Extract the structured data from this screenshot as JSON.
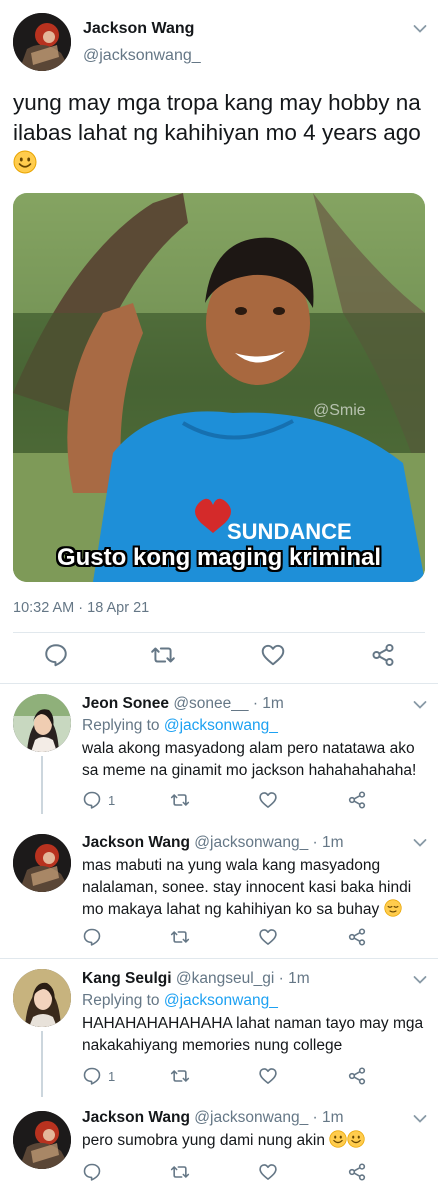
{
  "tweet": {
    "name": "Jackson Wang",
    "handle": "@jacksonwang_",
    "text": "yung may mga tropa kang may hobby na ilabas lahat ng kahihiyan mo 4 years ago",
    "media_caption": "Gusto kong maging kriminal",
    "media_watermark_top": "@Smie",
    "media_shirt_text": "SUNDANCE",
    "timestamp": "10:32 AM · 18 Apr 21"
  },
  "replies": [
    {
      "name": "Jeon Sonee",
      "meta": "@sonee__ · 1m",
      "replying_prefix": "Replying to ",
      "replying_to": "@jacksonwang_",
      "text": "wala akong masyadong alam pero natatawa ako sa meme na ginamit mo jackson hahahahahaha!",
      "reply_count": "1"
    },
    {
      "name": "Jackson Wang",
      "meta": "@jacksonwang_ · 1m",
      "text": "mas mabuti na yung wala kang masyadong nalalaman, sonee. stay innocent kasi baka hindi mo makaya lahat ng kahihiyan ko sa buhay"
    },
    {
      "name": "Kang Seulgi",
      "meta": "@kangseul_gi · 1m",
      "replying_prefix": "Replying to ",
      "replying_to": "@jacksonwang_",
      "text": "HAHAHAHAHAHAHA lahat naman tayo may mga nakakahiyang memories nung college",
      "reply_count": "1"
    },
    {
      "name": "Jackson Wang",
      "meta": "@jacksonwang_ · 1m",
      "text": "pero sumobra yung dami nung akin"
    }
  ],
  "icons": {
    "reply": "comment-icon",
    "retweet": "retweet-icon",
    "like": "heart-icon",
    "share": "share-icon",
    "more": "chevron-down-icon"
  },
  "colors": {
    "text": "#14171a",
    "muted": "#657786",
    "link": "#1da1f2",
    "divider": "#e1e8ed",
    "shirt": "#1e8fd8"
  }
}
